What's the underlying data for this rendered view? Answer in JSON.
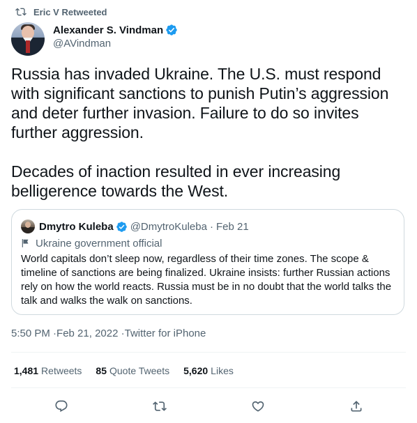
{
  "retweet": {
    "label": "Eric V Retweeted"
  },
  "author": {
    "display_name": "Alexander S. Vindman",
    "handle": "@AVindman"
  },
  "tweet": {
    "text": "Russia has invaded Ukraine. The U.S. must respond with significant sanctions to punish Putin’s aggression and deter further invasion. Failure to do so invites further aggression.\n\nDecades of inaction resulted in ever increasing belligerence towards the West."
  },
  "quote": {
    "display_name": "Dmytro Kuleba",
    "handle": "@DmytroKuleba",
    "separator": "·",
    "date": "Feb 21",
    "label": "Ukraine government official",
    "text": "World capitals don’t sleep now, regardless of their time zones. The scope & timeline of sanctions are being finalized. Ukraine insists: further Russian actions rely on how the world reacts. Russia must be in no doubt that the world talks the talk and walks the walk on sanctions."
  },
  "meta": {
    "time": "5:50 PM",
    "date": "Feb 21, 2022",
    "source": "Twitter for iPhone"
  },
  "stats": {
    "retweets_count": "1,481",
    "retweets_label": "Retweets",
    "quotes_count": "85",
    "quotes_label": "Quote Tweets",
    "likes_count": "5,620",
    "likes_label": "Likes"
  },
  "actions": [
    "reply-icon",
    "retweet-icon",
    "like-icon",
    "share-icon"
  ],
  "colors": {
    "text": "#0f1419",
    "secondary": "#536471",
    "verified": "#1d9bf0",
    "border": "#cfd9de"
  }
}
